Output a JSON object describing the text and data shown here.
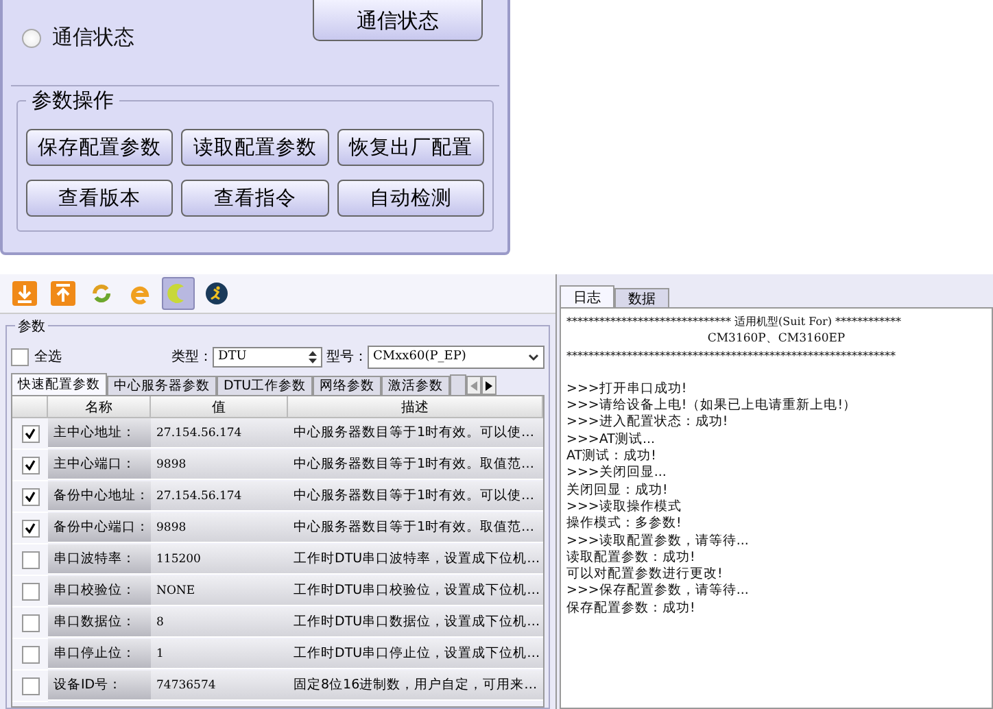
{
  "comm_panel": {
    "status_button": "通信状态",
    "radio": {
      "label": "通信状态",
      "checked": false
    }
  },
  "param_ops": {
    "title": "参数操作",
    "buttons": [
      "保存配置参数",
      "读取配置参数",
      "恢复出厂配置",
      "查看版本",
      "查看指令",
      "自动检测"
    ]
  },
  "toolbar": {
    "items": [
      {
        "kind": "download",
        "selected": false
      },
      {
        "kind": "upload",
        "selected": false
      },
      {
        "kind": "refresh",
        "selected": false
      },
      {
        "kind": "e",
        "selected": false
      },
      {
        "kind": "c",
        "selected": true
      },
      {
        "kind": "run",
        "selected": false
      }
    ]
  },
  "params": {
    "title": "参数",
    "select_all": {
      "label": "全选",
      "checked": false
    },
    "type_label": "类型：",
    "type_value": "DTU",
    "model_label": "型号：",
    "model_value": "CMxx60(P_EP)",
    "tabs": [
      {
        "label": "快速配置参数",
        "selected": true
      },
      {
        "label": "中心服务器参数",
        "selected": false
      },
      {
        "label": "DTU工作参数",
        "selected": false
      },
      {
        "label": "网络参数",
        "selected": false
      },
      {
        "label": "激活参数",
        "selected": false
      }
    ],
    "table": {
      "columns": [
        "名称",
        "值",
        "描述"
      ],
      "rows": [
        {
          "checked": true,
          "name": "主中心地址：",
          "value": "27.154.56.174",
          "desc": "中心服务器数目等于1时有效。可以使…"
        },
        {
          "checked": true,
          "name": "主中心端口：",
          "value": "9898",
          "desc": "中心服务器数目等于1时有效。取值范…"
        },
        {
          "checked": true,
          "name": "备份中心地址：",
          "value": "27.154.56.174",
          "desc": "中心服务器数目等于1时有效。可以使…"
        },
        {
          "checked": true,
          "name": "备份中心端口：",
          "value": "9898",
          "desc": "中心服务器数目等于1时有效。取值范…"
        },
        {
          "checked": false,
          "name": "串口波特率：",
          "value": "115200",
          "desc": "工作时DTU串口波特率，设置成下位机…"
        },
        {
          "checked": false,
          "name": "串口校验位：",
          "value": "NONE",
          "desc": "工作时DTU串口校验位，设置成下位机…"
        },
        {
          "checked": false,
          "name": "串口数据位：",
          "value": "8",
          "desc": "工作时DTU串口数据位，设置成下位机…"
        },
        {
          "checked": false,
          "name": "串口停止位：",
          "value": "1",
          "desc": "工作时DTU串口停止位，设置成下位机…"
        },
        {
          "checked": false,
          "name": "设备ID号：",
          "value": "74736574",
          "desc": "固定8位16进制数，用户自定，可用来…"
        }
      ]
    }
  },
  "log_panel": {
    "tabs": [
      {
        "label": "日志",
        "selected": true
      },
      {
        "label": "数据",
        "selected": false
      }
    ],
    "header": [
      "****************************** 适用机型(Suit For) ************",
      "CM3160P、CM3160EP",
      "************************************************************"
    ],
    "lines": [
      ">>>打开串口成功!",
      ">>>请给设备上电!（如果已上电请重新上电!）",
      ">>>进入配置状态：成功!",
      ">>>AT测试...",
      "AT测试：成功!",
      ">>>关闭回显...",
      "关闭回显：成功!",
      ">>>读取操作模式",
      "操作模式：多参数!",
      ">>>读取配置参数，请等待...",
      "读取配置参数：成功!",
      "可以对配置参数进行更改!",
      ">>>保存配置参数，请等待...",
      "保存配置参数：成功!"
    ]
  }
}
